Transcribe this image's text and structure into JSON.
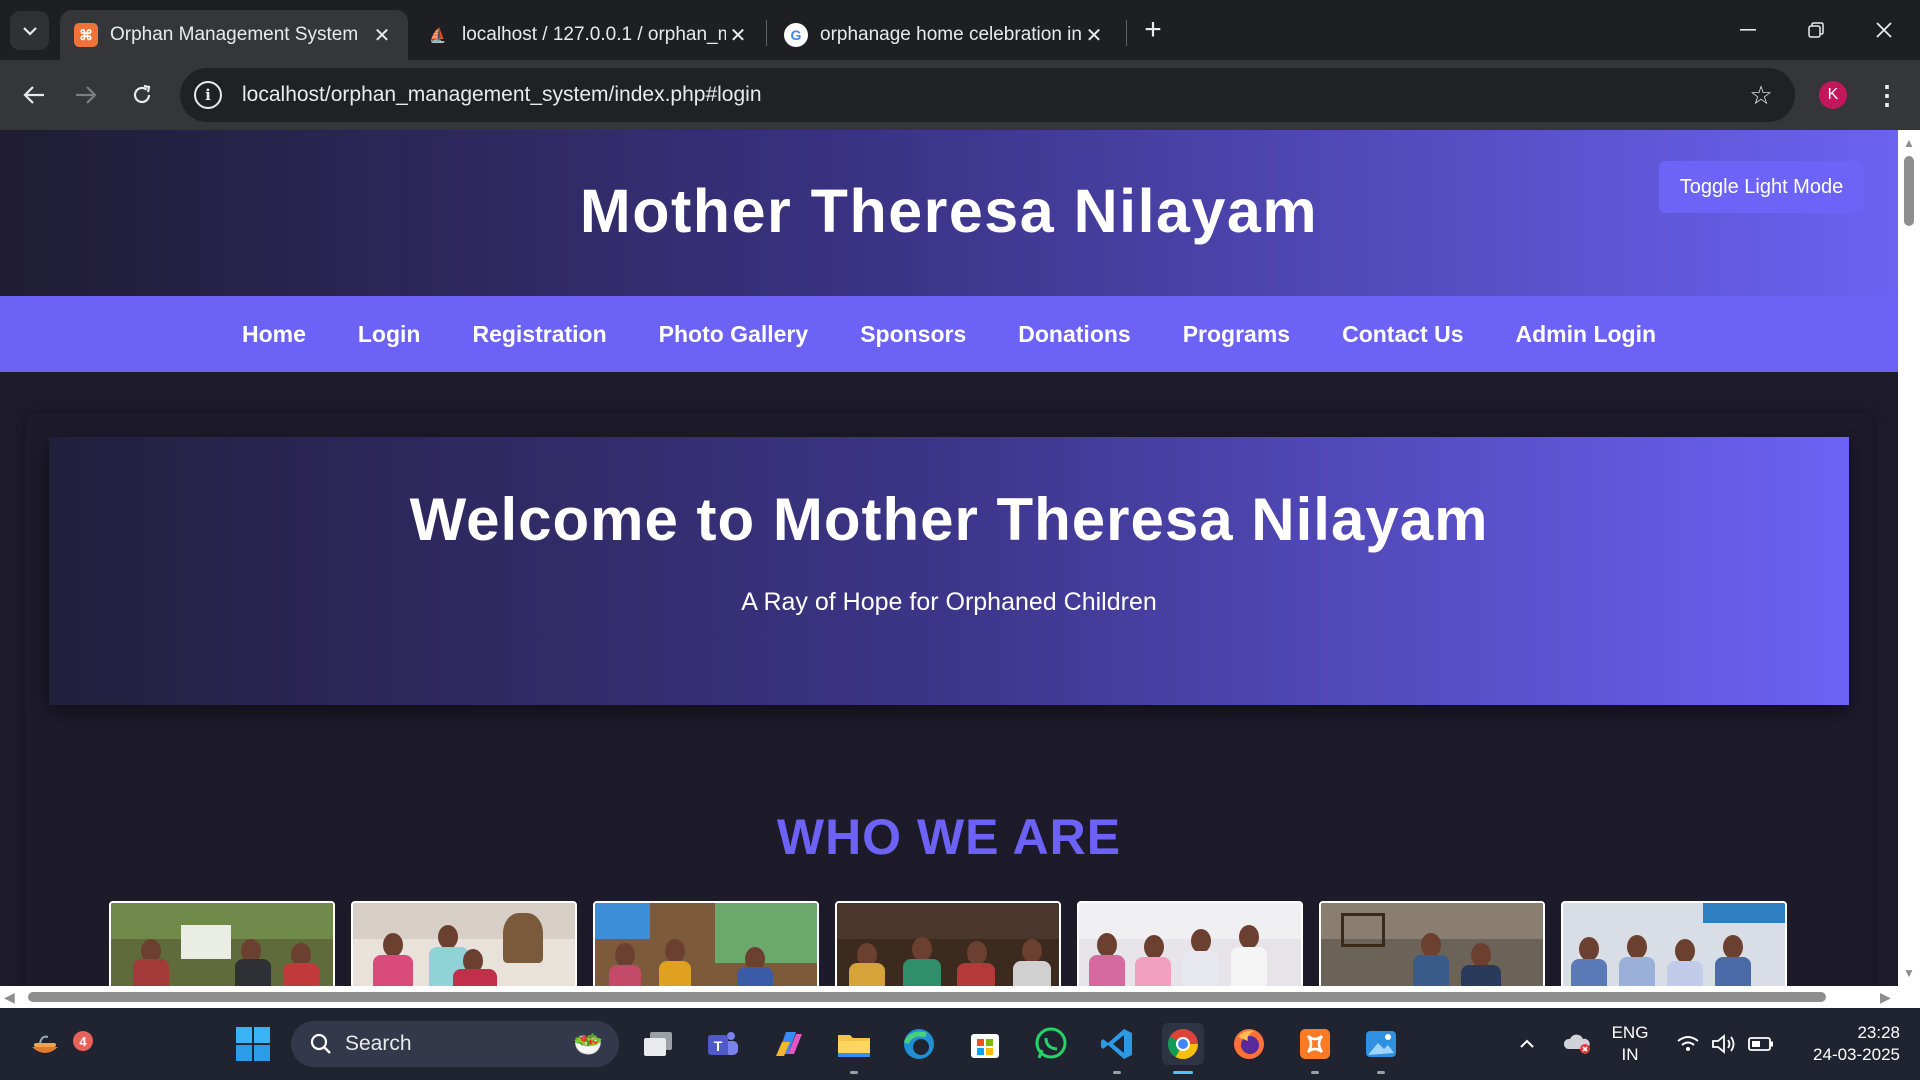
{
  "browser": {
    "tabs": [
      {
        "title": "Orphan Management System",
        "icon": "xampp-icon",
        "active": true
      },
      {
        "title": "localhost / 127.0.0.1 / orphan_m",
        "icon": "phpmyadmin-icon",
        "active": false
      },
      {
        "title": "orphanage home celebration in",
        "icon": "google-icon",
        "active": false
      }
    ],
    "url": "localhost/orphan_management_system/index.php#login",
    "profile_initial": "K"
  },
  "site": {
    "title": "Mother Theresa Nilayam",
    "toggle_label": "Toggle Light Mode",
    "nav": [
      "Home",
      "Login",
      "Registration",
      "Photo Gallery",
      "Sponsors",
      "Donations",
      "Programs",
      "Contact Us",
      "Admin Login"
    ],
    "hero_title": "Welcome to Mother Theresa Nilayam",
    "hero_subtitle": "A Ray of Hope for Orphaned Children",
    "section_title": "WHO WE ARE",
    "accent_color": "#6c62f5"
  },
  "taskbar": {
    "search_label": "Search",
    "widgets_badge": "4",
    "language_line1": "ENG",
    "language_line2": "IN",
    "time": "23:28",
    "date": "24-03-2025"
  }
}
